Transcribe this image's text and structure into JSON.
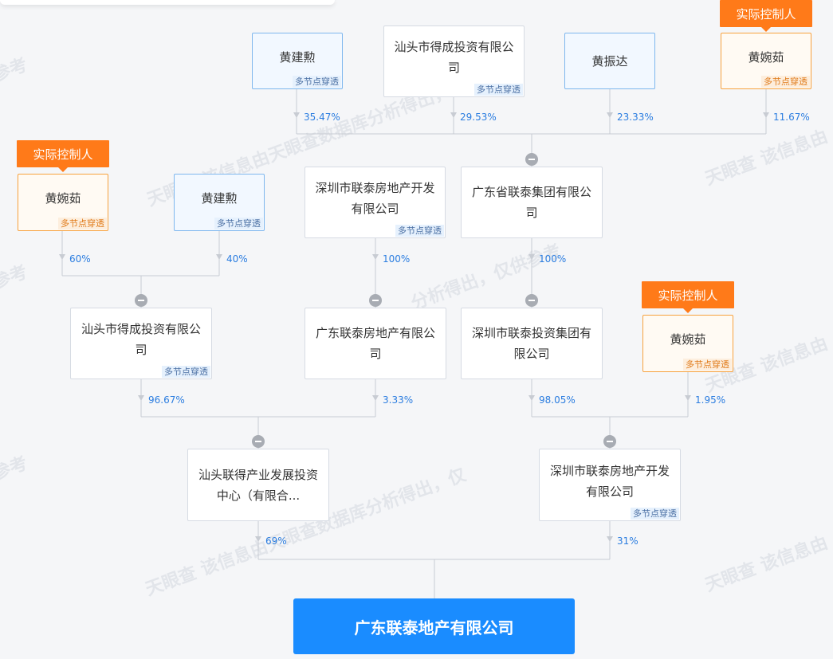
{
  "watermarks": {
    "brand": "天眼查",
    "notice": "该信息由天眼查数据库分析得出，仅供参考",
    "fragment_1": "参考",
    "fragment_2": "该信息由天眼查数据库分析得出，仅供参考",
    "fragment_3": "分析得出，仅供参考",
    "fragment_4": "该信息由",
    "fragment_5": "该信息由天眼查数据库分析得出，仅"
  },
  "labels": {
    "actual_controller": "实际控制人",
    "multi_node": "多节点穿透"
  },
  "row1": {
    "n1": {
      "name": "黄建勲",
      "pct": "35.47%"
    },
    "n2": {
      "name": "汕头市得成投资有限公司",
      "pct": "29.53%"
    },
    "n3": {
      "name": "黄振达",
      "pct": "23.33%"
    },
    "n4": {
      "name": "黄婉茹",
      "pct": "11.67%"
    }
  },
  "row2": {
    "n1": {
      "name": "黄婉茹",
      "pct": "60%"
    },
    "n2": {
      "name": "黄建勲",
      "pct": "40%"
    },
    "n3": {
      "name": "深圳市联泰房地产开发有限公司",
      "pct": "100%"
    },
    "n4": {
      "name": "广东省联泰集团有限公司",
      "pct": "100%"
    }
  },
  "row3": {
    "n1": {
      "name": "汕头市得成投资有限公司",
      "pct": "96.67%"
    },
    "n2": {
      "name": "广东联泰房地产有限公司",
      "pct": "3.33%"
    },
    "n3": {
      "name": "深圳市联泰投资集团有限公司",
      "pct": "98.05%"
    },
    "n4": {
      "name": "黄婉茹",
      "pct": "1.95%"
    }
  },
  "row4": {
    "n1": {
      "name": "汕头联得产业发展投资中心（有限合...",
      "pct": "69%"
    },
    "n2": {
      "name": "深圳市联泰房地产开发有限公司",
      "pct": "31%"
    }
  },
  "target": {
    "name": "广东联泰地产有限公司"
  },
  "colors": {
    "target": "#1a8cff",
    "controller": "#ff7a19",
    "person_border": "#7fb7ee",
    "percent": "#2b7de0"
  }
}
